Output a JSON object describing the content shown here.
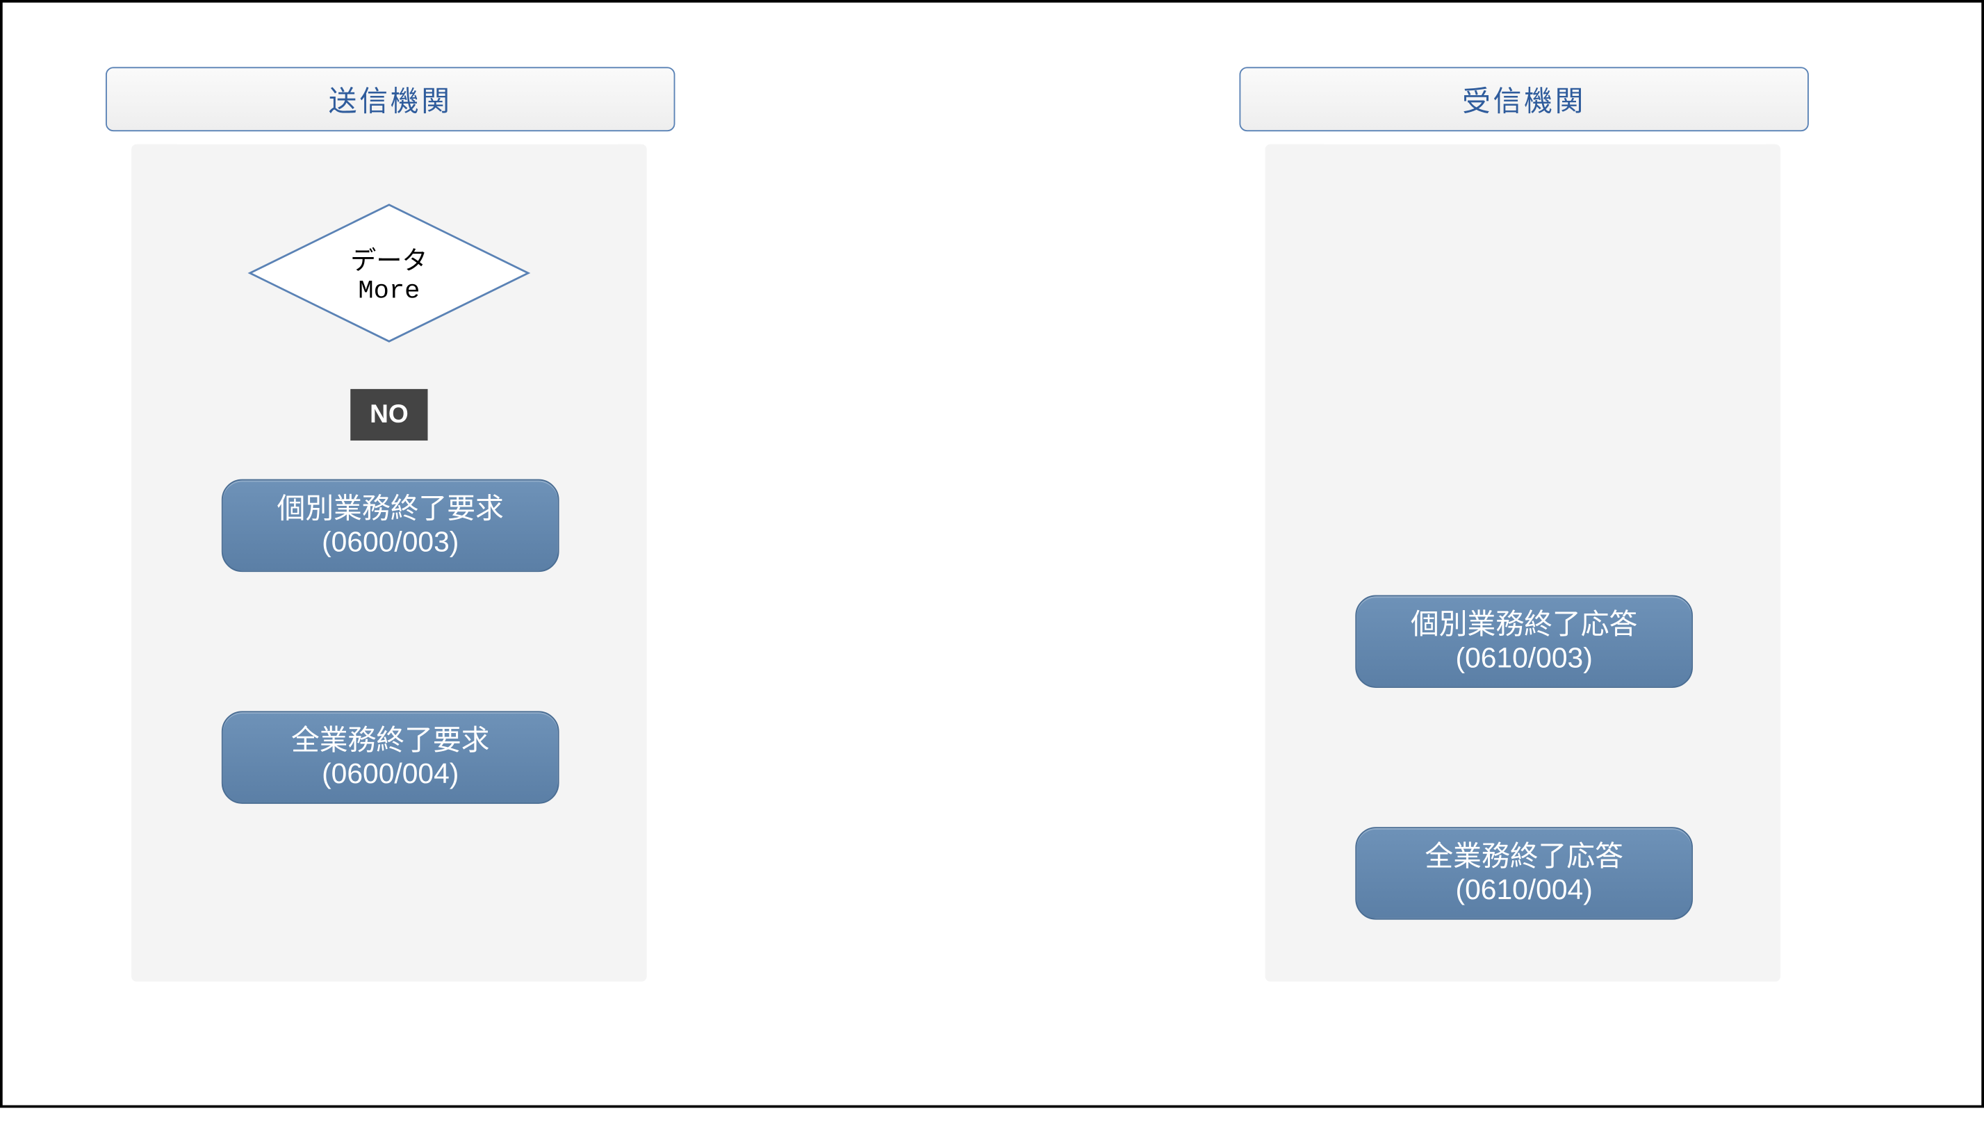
{
  "lanes": {
    "sender": {
      "header": "送信機関"
    },
    "receiver": {
      "header": "受信機関"
    }
  },
  "decision": {
    "line1": "データ",
    "line2": "More"
  },
  "no_label": "NO",
  "messages": {
    "m1": {
      "title": "個別業務終了要求",
      "code": "(0600/003)"
    },
    "m2": {
      "title": "個別業務終了応答",
      "code": "(0610/003)"
    },
    "m3": {
      "title": "全業務終了要求",
      "code": "(0600/004)"
    },
    "m4": {
      "title": "全業務終了応答",
      "code": "(0610/004)"
    }
  }
}
